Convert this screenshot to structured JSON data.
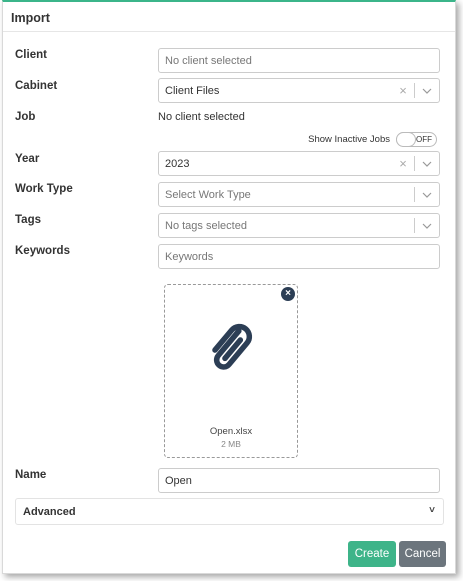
{
  "dialog": {
    "title": "Import"
  },
  "form": {
    "client": {
      "label": "Client",
      "placeholder": "No client selected"
    },
    "cabinet": {
      "label": "Cabinet",
      "value": "Client Files",
      "clear": "×"
    },
    "job": {
      "label": "Job",
      "value": "No client selected"
    },
    "show_inactive": {
      "label": "Show Inactive Jobs",
      "state": "OFF"
    },
    "year": {
      "label": "Year",
      "value": "2023",
      "clear": "×"
    },
    "work_type": {
      "label": "Work Type",
      "placeholder": "Select Work Type"
    },
    "tags": {
      "label": "Tags",
      "placeholder": "No tags selected"
    },
    "keywords": {
      "label": "Keywords",
      "placeholder": "Keywords"
    },
    "attachment": {
      "file_name": "Open.xlsx",
      "file_size": "2 MB",
      "icon": "paperclip-icon",
      "remove": "×"
    },
    "name": {
      "label": "Name",
      "value": "Open"
    },
    "advanced": {
      "label": "Advanced",
      "chevron": "˅"
    }
  },
  "actions": {
    "create_label": "Create",
    "cancel_label": "Cancel"
  },
  "colors": {
    "accent": "#3eb489",
    "cancel": "#6c757d",
    "icon_dark": "#2c3e55"
  }
}
